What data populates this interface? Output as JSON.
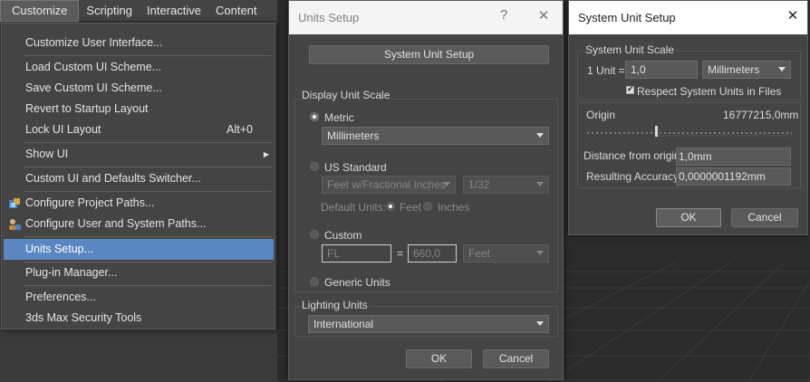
{
  "menubar": {
    "items": [
      "Customize",
      "Scripting",
      "Interactive",
      "Content"
    ]
  },
  "menu": {
    "items": [
      {
        "label": "Customize User Interface..."
      },
      {
        "label": "Load Custom UI Scheme..."
      },
      {
        "label": "Save Custom UI Scheme..."
      },
      {
        "label": "Revert to Startup Layout"
      },
      {
        "label": "Lock UI Layout",
        "shortcut": "Alt+0"
      },
      {
        "label": "Show UI"
      },
      {
        "label": "Custom UI and Defaults Switcher..."
      },
      {
        "label": "Configure Project Paths..."
      },
      {
        "label": "Configure User and System Paths..."
      },
      {
        "label": "Units Setup..."
      },
      {
        "label": "Plug-in Manager..."
      },
      {
        "label": "Preferences..."
      },
      {
        "label": "3ds Max Security Tools"
      }
    ]
  },
  "units_dialog": {
    "title": "Units Setup",
    "help_glyph": "?",
    "close_glyph": "✕",
    "system_unit_setup_label": "System Unit Setup",
    "display_unit_scale_label": "Display Unit Scale",
    "metric_label": "Metric",
    "metric_select": "Millimeters",
    "us_standard_label": "US Standard",
    "us_select": "Feet w/Fractional Inches",
    "us_fraction_select": "1/32",
    "default_units_label": "Default Units:",
    "feet_label": "Feet",
    "inches_label": "Inches",
    "custom_label": "Custom",
    "custom_name": "FL",
    "equals": "=",
    "custom_value": "660,0",
    "custom_unit_select": "Feet",
    "generic_units_label": "Generic Units",
    "lighting_units_label": "Lighting Units",
    "lighting_select": "International",
    "ok_label": "OK",
    "cancel_label": "Cancel"
  },
  "system_dialog": {
    "title": "System Unit Setup",
    "close_glyph": "✕",
    "system_unit_scale_label": "System Unit Scale",
    "one_unit_label": "1 Unit =",
    "unit_value": "1,0",
    "unit_select": "Millimeters",
    "respect_label": "Respect System Units in Files",
    "origin_label": "Origin",
    "origin_value": "16777215,0mm",
    "distance_label": "Distance from origin:",
    "distance_value": "1,0mm",
    "accuracy_label": "Resulting Accuracy:",
    "accuracy_value": "0,0000001192mm",
    "ok_label": "OK",
    "cancel_label": "Cancel"
  }
}
